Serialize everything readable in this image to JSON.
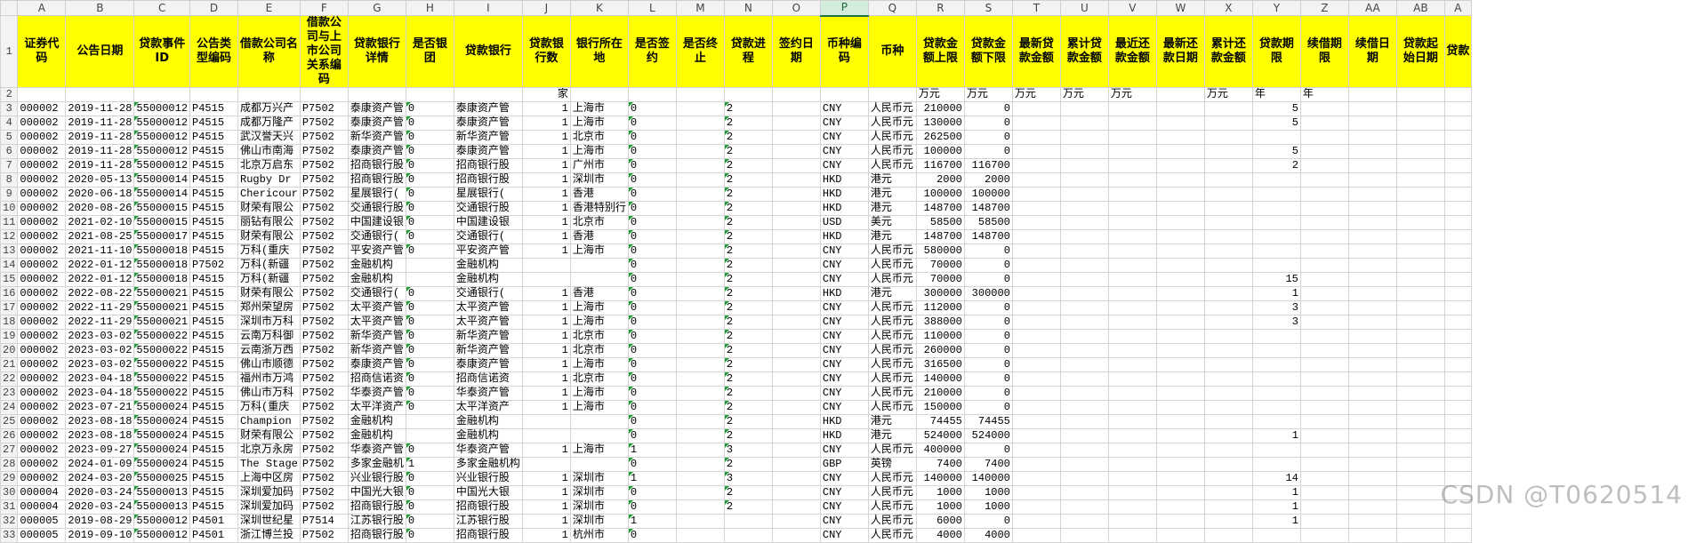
{
  "column_letters": [
    "A",
    "B",
    "C",
    "D",
    "E",
    "F",
    "G",
    "H",
    "I",
    "J",
    "K",
    "L",
    "M",
    "N",
    "O",
    "P",
    "Q",
    "R",
    "S",
    "T",
    "U",
    "V",
    "W",
    "X",
    "Y",
    "Z",
    "AA",
    "AB",
    "A"
  ],
  "selected_column": "P",
  "header_row": {
    "row_number": "1",
    "labels": [
      "证券代码",
      "公告日期",
      "贷款事件ID",
      "公告类型编码",
      "借款公司名称",
      "借款公司与上市公司关系编码",
      "贷款银行详情",
      "是否银团",
      "贷款银行",
      "贷款银行数",
      "银行所在地",
      "是否签约",
      "是否终止",
      "贷款进程",
      "签约日期",
      "币种编码",
      "币种",
      "贷款金额上限",
      "贷款金额下限",
      "最新贷款金额",
      "累计贷款金额",
      "最近还款金额",
      "最新还款日期",
      "累计还款金额",
      "贷款期限",
      "续借期限",
      "续借日期",
      "贷款起始日期",
      "贷款"
    ]
  },
  "unit_row": {
    "row_number": "2",
    "cells": [
      "",
      "",
      "",
      "",
      "",
      "",
      "",
      "",
      "",
      "家",
      "",
      "",
      "",
      "",
      "",
      "",
      "",
      "万元",
      "万元",
      "万元",
      "万元",
      "万元",
      "",
      "万元",
      "年",
      "年",
      "",
      "",
      ""
    ]
  },
  "rows": [
    {
      "n": "3",
      "c": [
        "000002",
        "2019-11-28",
        "55000012",
        "P4515",
        "成都万兴产",
        "P7502",
        "泰康资产管",
        "0",
        "泰康资产管",
        "1",
        "上海市",
        "0",
        "",
        "2",
        "",
        "CNY",
        "人民币元",
        "210000",
        "0",
        "",
        "",
        "",
        "",
        "",
        "5",
        "",
        "",
        "",
        ""
      ]
    },
    {
      "n": "4",
      "c": [
        "000002",
        "2019-11-28",
        "55000012",
        "P4515",
        "成都万隆产",
        "P7502",
        "泰康资产管",
        "0",
        "泰康资产管",
        "1",
        "上海市",
        "0",
        "",
        "2",
        "",
        "CNY",
        "人民币元",
        "130000",
        "0",
        "",
        "",
        "",
        "",
        "",
        "5",
        "",
        "",
        "",
        ""
      ]
    },
    {
      "n": "5",
      "c": [
        "000002",
        "2019-11-28",
        "55000012",
        "P4515",
        "武汉誉天兴",
        "P7502",
        "新华资产管",
        "0",
        "新华资产管",
        "1",
        "北京市",
        "0",
        "",
        "2",
        "",
        "CNY",
        "人民币元",
        "262500",
        "0",
        "",
        "",
        "",
        "",
        "",
        "",
        "",
        "",
        "",
        ""
      ]
    },
    {
      "n": "6",
      "c": [
        "000002",
        "2019-11-28",
        "55000012",
        "P4515",
        "佛山市南海",
        "P7502",
        "泰康资产管",
        "0",
        "泰康资产管",
        "1",
        "上海市",
        "0",
        "",
        "2",
        "",
        "CNY",
        "人民币元",
        "100000",
        "0",
        "",
        "",
        "",
        "",
        "",
        "5",
        "",
        "",
        "",
        ""
      ]
    },
    {
      "n": "7",
      "c": [
        "000002",
        "2019-11-28",
        "55000012",
        "P4515",
        "北京万启东",
        "P7502",
        "招商银行股",
        "0",
        "招商银行股",
        "1",
        "广州市",
        "0",
        "",
        "2",
        "",
        "CNY",
        "人民币元",
        "116700",
        "116700",
        "",
        "",
        "",
        "",
        "",
        "2",
        "",
        "",
        "",
        ""
      ]
    },
    {
      "n": "8",
      "c": [
        "000002",
        "2020-05-13",
        "55000014",
        "P4515",
        "Rugby Dr",
        "P7502",
        "招商银行股",
        "0",
        "招商银行股",
        "1",
        "深圳市",
        "0",
        "",
        "2",
        "",
        "HKD",
        "港元",
        "2000",
        "2000",
        "",
        "",
        "",
        "",
        "",
        "",
        "",
        "",
        "",
        ""
      ]
    },
    {
      "n": "9",
      "c": [
        "000002",
        "2020-06-18",
        "55000014",
        "P4515",
        "Chericour",
        "P7502",
        "星展银行(",
        "0",
        "星展银行(",
        "1",
        "香港",
        "0",
        "",
        "2",
        "",
        "HKD",
        "港元",
        "100000",
        "100000",
        "",
        "",
        "",
        "",
        "",
        "",
        "",
        "",
        "",
        ""
      ]
    },
    {
      "n": "10",
      "c": [
        "000002",
        "2020-08-26",
        "55000015",
        "P4515",
        "财荣有限公",
        "P7502",
        "交通银行股",
        "0",
        "交通银行股",
        "1",
        "香港特别行",
        "0",
        "",
        "2",
        "",
        "HKD",
        "港元",
        "148700",
        "148700",
        "",
        "",
        "",
        "",
        "",
        "",
        "",
        "",
        "",
        ""
      ]
    },
    {
      "n": "11",
      "c": [
        "000002",
        "2021-02-10",
        "55000015",
        "P4515",
        "丽钻有限公",
        "P7502",
        "中国建设银",
        "0",
        "中国建设银",
        "1",
        "北京市",
        "0",
        "",
        "2",
        "",
        "USD",
        "美元",
        "58500",
        "58500",
        "",
        "",
        "",
        "",
        "",
        "",
        "",
        "",
        "",
        ""
      ]
    },
    {
      "n": "12",
      "c": [
        "000002",
        "2021-08-25",
        "55000017",
        "P4515",
        "财荣有限公",
        "P7502",
        "交通银行(",
        "0",
        "交通银行(",
        "1",
        "香港",
        "0",
        "",
        "2",
        "",
        "HKD",
        "港元",
        "148700",
        "148700",
        "",
        "",
        "",
        "",
        "",
        "",
        "",
        "",
        "",
        ""
      ]
    },
    {
      "n": "13",
      "c": [
        "000002",
        "2021-11-10",
        "55000018",
        "P4515",
        "万科(重庆",
        "P7502",
        "平安资产管",
        "0",
        "平安资产管",
        "1",
        "上海市",
        "0",
        "",
        "2",
        "",
        "CNY",
        "人民币元",
        "580000",
        "0",
        "",
        "",
        "",
        "",
        "",
        "",
        "",
        "",
        "",
        ""
      ]
    },
    {
      "n": "14",
      "c": [
        "000002",
        "2022-01-12",
        "55000018",
        "P7502",
        "万科(新疆",
        "P7502",
        "金融机构",
        "",
        "金融机构",
        "",
        "",
        "0",
        "",
        "2",
        "",
        "CNY",
        "人民币元",
        "70000",
        "0",
        "",
        "",
        "",
        "",
        "",
        "",
        "",
        "",
        "",
        ""
      ]
    },
    {
      "n": "15",
      "c": [
        "000002",
        "2022-01-12",
        "55000018",
        "P4515",
        "万科(新疆",
        "P7502",
        "金融机构",
        "",
        "金融机构",
        "",
        "",
        "0",
        "",
        "2",
        "",
        "CNY",
        "人民币元",
        "70000",
        "0",
        "",
        "",
        "",
        "",
        "",
        "15",
        "",
        "",
        "",
        ""
      ]
    },
    {
      "n": "16",
      "c": [
        "000002",
        "2022-08-22",
        "55000021",
        "P4515",
        "财荣有限公",
        "P7502",
        "交通银行(",
        "0",
        "交通银行(",
        "1",
        "香港",
        "0",
        "",
        "2",
        "",
        "HKD",
        "港元",
        "300000",
        "300000",
        "",
        "",
        "",
        "",
        "",
        "1",
        "",
        "",
        "",
        ""
      ]
    },
    {
      "n": "17",
      "c": [
        "000002",
        "2022-11-29",
        "55000021",
        "P4515",
        "郑州荣望房",
        "P7502",
        "太平资产管",
        "0",
        "太平资产管",
        "1",
        "上海市",
        "0",
        "",
        "2",
        "",
        "CNY",
        "人民币元",
        "112000",
        "0",
        "",
        "",
        "",
        "",
        "",
        "3",
        "",
        "",
        "",
        ""
      ]
    },
    {
      "n": "18",
      "c": [
        "000002",
        "2022-11-29",
        "55000021",
        "P4515",
        "深圳市万科",
        "P7502",
        "太平资产管",
        "0",
        "太平资产管",
        "1",
        "上海市",
        "0",
        "",
        "2",
        "",
        "CNY",
        "人民币元",
        "388000",
        "0",
        "",
        "",
        "",
        "",
        "",
        "3",
        "",
        "",
        "",
        ""
      ]
    },
    {
      "n": "19",
      "c": [
        "000002",
        "2023-03-02",
        "55000022",
        "P4515",
        "云南万科御",
        "P7502",
        "新华资产管",
        "0",
        "新华资产管",
        "1",
        "北京市",
        "0",
        "",
        "2",
        "",
        "CNY",
        "人民币元",
        "110000",
        "0",
        "",
        "",
        "",
        "",
        "",
        "",
        "",
        "",
        "",
        ""
      ]
    },
    {
      "n": "20",
      "c": [
        "000002",
        "2023-03-02",
        "55000022",
        "P4515",
        "云南浙万西",
        "P7502",
        "新华资产管",
        "0",
        "新华资产管",
        "1",
        "北京市",
        "0",
        "",
        "2",
        "",
        "CNY",
        "人民币元",
        "260000",
        "0",
        "",
        "",
        "",
        "",
        "",
        "",
        "",
        "",
        "",
        ""
      ]
    },
    {
      "n": "21",
      "c": [
        "000002",
        "2023-03-02",
        "55000022",
        "P4515",
        "佛山市顺德",
        "P7502",
        "泰康资产管",
        "0",
        "泰康资产管",
        "1",
        "上海市",
        "0",
        "",
        "2",
        "",
        "CNY",
        "人民币元",
        "316500",
        "0",
        "",
        "",
        "",
        "",
        "",
        "",
        "",
        "",
        "",
        ""
      ]
    },
    {
      "n": "22",
      "c": [
        "000002",
        "2023-04-18",
        "55000022",
        "P4515",
        "福州市万鸿",
        "P7502",
        "招商信诺资",
        "0",
        "招商信诺资",
        "1",
        "北京市",
        "0",
        "",
        "2",
        "",
        "CNY",
        "人民币元",
        "140000",
        "0",
        "",
        "",
        "",
        "",
        "",
        "",
        "",
        "",
        "",
        ""
      ]
    },
    {
      "n": "23",
      "c": [
        "000002",
        "2023-04-18",
        "55000022",
        "P4515",
        "佛山市万科",
        "P7502",
        "华泰资产管",
        "0",
        "华泰资产管",
        "1",
        "上海市",
        "0",
        "",
        "2",
        "",
        "CNY",
        "人民币元",
        "210000",
        "0",
        "",
        "",
        "",
        "",
        "",
        "",
        "",
        "",
        "",
        ""
      ]
    },
    {
      "n": "24",
      "c": [
        "000002",
        "2023-07-21",
        "55000024",
        "P4515",
        "万科(重庆",
        "P7502",
        "太平洋资产",
        "0",
        "太平洋资产",
        "1",
        "上海市",
        "0",
        "",
        "2",
        "",
        "CNY",
        "人民币元",
        "150000",
        "0",
        "",
        "",
        "",
        "",
        "",
        "",
        "",
        "",
        "",
        ""
      ]
    },
    {
      "n": "25",
      "c": [
        "000002",
        "2023-08-18",
        "55000024",
        "P4515",
        "Champion",
        "P7502",
        "金融机构",
        "",
        "金融机构",
        "",
        "",
        "0",
        "",
        "2",
        "",
        "HKD",
        "港元",
        "74455",
        "74455",
        "",
        "",
        "",
        "",
        "",
        "",
        "",
        "",
        "",
        ""
      ]
    },
    {
      "n": "26",
      "c": [
        "000002",
        "2023-08-18",
        "55000024",
        "P4515",
        "财荣有限公",
        "P7502",
        "金融机构",
        "",
        "金融机构",
        "",
        "",
        "0",
        "",
        "2",
        "",
        "HKD",
        "港元",
        "524000",
        "524000",
        "",
        "",
        "",
        "",
        "",
        "1",
        "",
        "",
        "",
        ""
      ]
    },
    {
      "n": "27",
      "c": [
        "000002",
        "2023-09-27",
        "55000024",
        "P4515",
        "北京万永房",
        "P7502",
        "华泰资产管",
        "0",
        "华泰资产管",
        "1",
        "上海市",
        "1",
        "",
        "3",
        "",
        "CNY",
        "人民币元",
        "400000",
        "0",
        "",
        "",
        "",
        "",
        "",
        "",
        "",
        "",
        "",
        ""
      ]
    },
    {
      "n": "28",
      "c": [
        "000002",
        "2024-01-09",
        "55000024",
        "P4515",
        "The Stage",
        "P7502",
        "多家金融机",
        "1",
        "多家金融机构",
        "",
        "",
        "0",
        "",
        "2",
        "",
        "GBP",
        "英镑",
        "7400",
        "7400",
        "",
        "",
        "",
        "",
        "",
        "",
        "",
        "",
        "",
        ""
      ]
    },
    {
      "n": "29",
      "c": [
        "000002",
        "2024-03-20",
        "55000025",
        "P4515",
        "上海中区房",
        "P7502",
        "兴业银行股",
        "0",
        "兴业银行股",
        "1",
        "深圳市",
        "1",
        "",
        "3",
        "",
        "CNY",
        "人民币元",
        "140000",
        "140000",
        "",
        "",
        "",
        "",
        "",
        "14",
        "",
        "",
        "",
        ""
      ]
    },
    {
      "n": "30",
      "c": [
        "000004",
        "2020-03-24",
        "55000013",
        "P4515",
        "深圳爱加码",
        "P7502",
        "中国光大银",
        "0",
        "中国光大银",
        "1",
        "深圳市",
        "0",
        "",
        "2",
        "",
        "CNY",
        "人民币元",
        "1000",
        "1000",
        "",
        "",
        "",
        "",
        "",
        "1",
        "",
        "",
        "",
        ""
      ]
    },
    {
      "n": "31",
      "c": [
        "000004",
        "2020-03-24",
        "55000013",
        "P4515",
        "深圳爱加码",
        "P7502",
        "招商银行股",
        "0",
        "招商银行股",
        "1",
        "深圳市",
        "0",
        "",
        "2",
        "",
        "CNY",
        "人民币元",
        "1000",
        "1000",
        "",
        "",
        "",
        "",
        "",
        "1",
        "",
        "",
        "",
        ""
      ]
    },
    {
      "n": "32",
      "c": [
        "000005",
        "2019-08-29",
        "55000012",
        "P4501",
        "深圳世纪星",
        "P7514",
        "江苏银行股",
        "0",
        "江苏银行股",
        "1",
        "深圳市",
        "1",
        "",
        "",
        "",
        "CNY",
        "人民币元",
        "6000",
        "0",
        "",
        "",
        "",
        "",
        "",
        "1",
        "",
        "",
        "",
        ""
      ]
    },
    {
      "n": "33",
      "c": [
        "000005",
        "2019-09-10",
        "55000012",
        "P4501",
        "浙江博兰投",
        "P7502",
        "招商银行股",
        "0",
        "招商银行股",
        "1",
        "杭州市",
        "0",
        "",
        "",
        "",
        "CNY",
        "人民币元",
        "4000",
        "4000",
        "",
        "",
        "",
        "",
        "",
        "",
        "",
        "",
        "",
        ""
      ]
    }
  ],
  "watermark": "CSDN @T0620514"
}
